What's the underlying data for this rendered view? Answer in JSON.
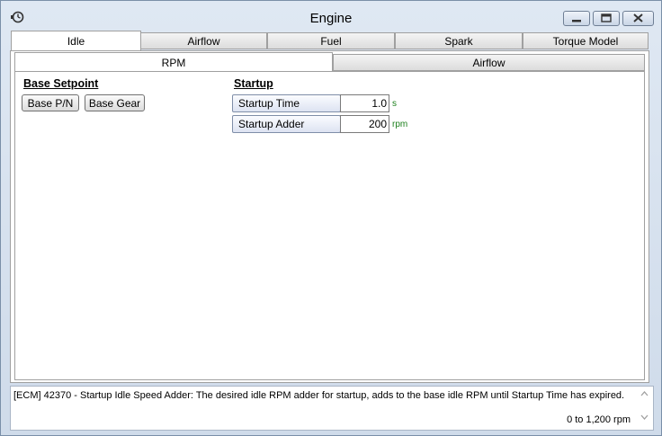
{
  "window": {
    "title": "Engine"
  },
  "main_tabs": [
    "Idle",
    "Airflow",
    "Fuel",
    "Spark",
    "Torque Model"
  ],
  "sub_tabs": [
    "RPM",
    "Airflow"
  ],
  "base_setpoint": {
    "title": "Base Setpoint",
    "buttons": [
      "Base P/N",
      "Base Gear"
    ]
  },
  "startup": {
    "title": "Startup",
    "params": [
      {
        "label": "Startup Time",
        "value": "1.0",
        "unit": "s"
      },
      {
        "label": "Startup Adder",
        "value": "200",
        "unit": "rpm"
      }
    ]
  },
  "status": {
    "description": "[ECM] 42370 - Startup Idle Speed Adder: The desired idle RPM adder for startup, adds to the base idle RPM until Startup Time has expired.",
    "range": "0 to 1,200 rpm"
  },
  "icons": {
    "app": "clock-gear-icon",
    "minimize": "minimize-icon",
    "maximize": "maximize-icon",
    "close": "close-icon",
    "scroll_up": "chevron-up-icon",
    "scroll_down": "chevron-down-icon"
  },
  "colors": {
    "unit_text": "#1b7f1b",
    "window_frame": "#dfe8f3"
  }
}
